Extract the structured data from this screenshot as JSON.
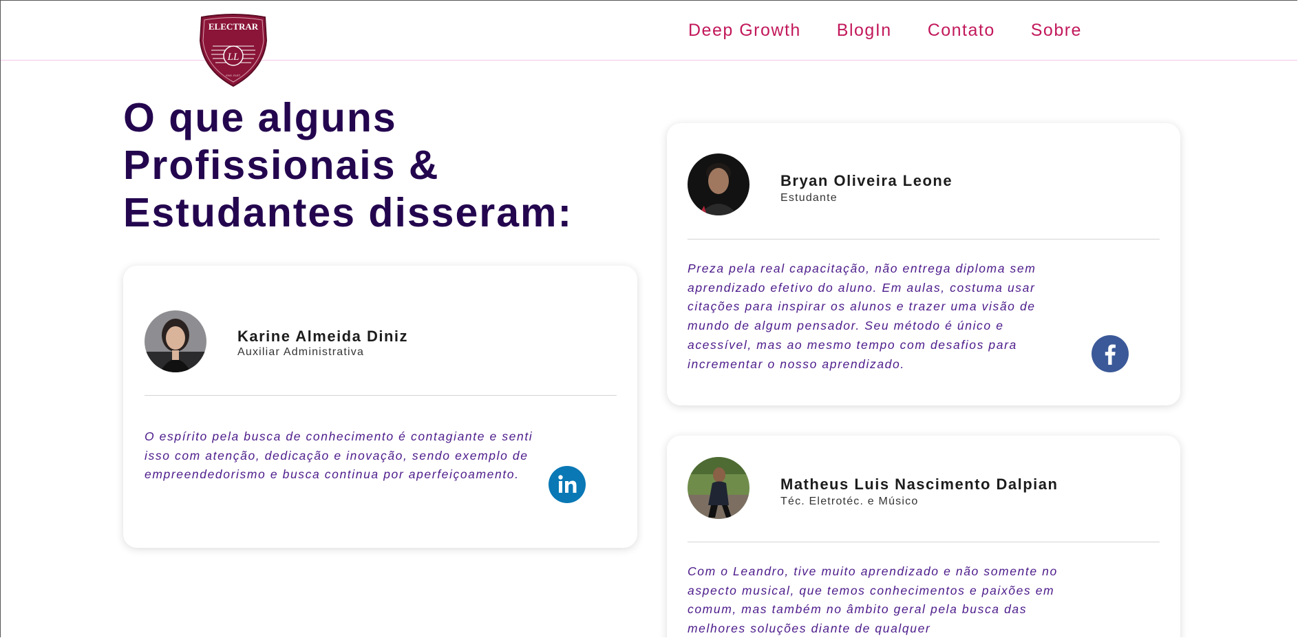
{
  "header": {
    "nav": [
      "Deep Growth",
      "BlogIn",
      "Contato",
      "Sobre"
    ]
  },
  "logo": {
    "text": "ELECTRAR",
    "monogram": "LL",
    "small": "ENG. ELET."
  },
  "heading": {
    "line1": "O que alguns",
    "line2": "Profissionais &",
    "line3": "Estudantes disseram:"
  },
  "testimonials": [
    {
      "name": "Karine Almeida Diniz",
      "role": "Auxiliar Administrativa",
      "quote": "O espírito pela busca de conhecimento é contagiante e senti isso com atenção, dedicação e inovação, sendo exemplo de empreendedorismo e busca continua por aperfeiçoamento.",
      "social_icon": "linkedin-icon"
    },
    {
      "name": "Bryan Oliveira Leone",
      "role": "Estudante",
      "quote": "Preza pela real capacitação, não entrega diploma sem aprendizado efetivo do aluno. Em aulas, costuma usar citações para inspirar os alunos e trazer uma visão de mundo de algum pensador. Seu método é único e acessível, mas ao mesmo tempo com desafios para incrementar o nosso aprendizado.",
      "social_icon": "facebook-icon"
    },
    {
      "name": "Matheus Luis Nascimento Dalpian",
      "role": "Téc. Eletrotéc. e Músico",
      "quote": "Com o Leandro, tive muito aprendizado e não somente no aspecto musical, que temos conhecimentos e paixões em comum, mas também no âmbito geral pela busca das melhores soluções diante de qualquer",
      "social_icon": ""
    }
  ],
  "colors": {
    "nav": "#c2185b",
    "heading": "#24064f",
    "quote": "#4b1a8a",
    "logo": "#8a1538",
    "linkedin": "#0a78b5",
    "facebook": "#3b5998"
  }
}
